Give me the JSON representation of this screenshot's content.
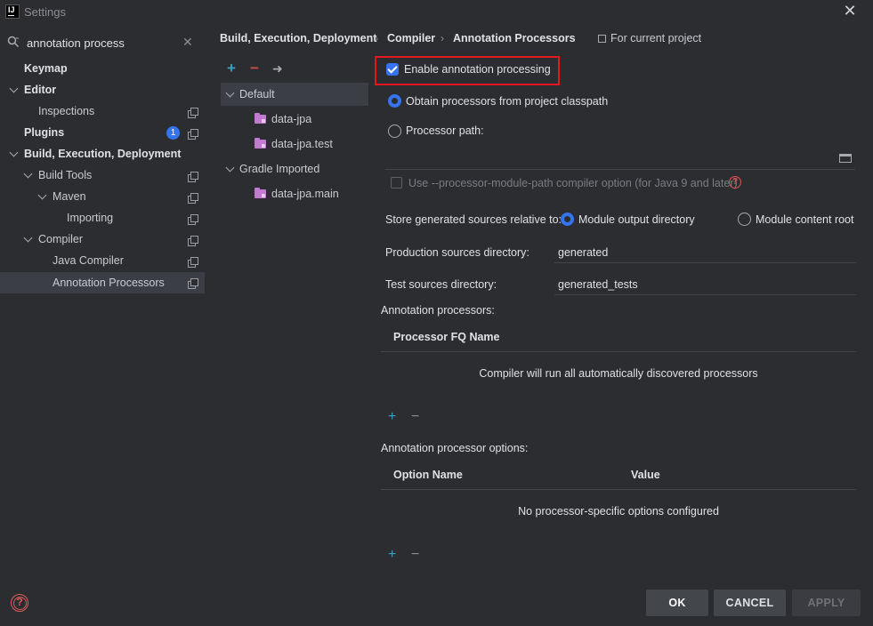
{
  "window": {
    "app_icon": "IJ",
    "title": "Settings"
  },
  "search": {
    "value": "annotation process"
  },
  "sidebar": {
    "items": [
      {
        "label": "Keymap"
      },
      {
        "label": "Editor"
      },
      {
        "label": "Inspections"
      },
      {
        "label": "Plugins",
        "badge": "1"
      },
      {
        "label": "Build, Execution, Deployment"
      },
      {
        "label": "Build Tools"
      },
      {
        "label": "Maven"
      },
      {
        "label": "Importing"
      },
      {
        "label": "Compiler"
      },
      {
        "label": "Java Compiler"
      },
      {
        "label": "Annotation Processors"
      }
    ]
  },
  "breadcrumb": {
    "items": [
      "Build, Execution, Deployment",
      "Compiler",
      "Annotation Processors"
    ],
    "separator": "›",
    "scope": "For current project"
  },
  "profiles": {
    "toolbar": {
      "add": "+",
      "remove": "−",
      "move": "➜"
    },
    "items": [
      {
        "label": "Default"
      },
      {
        "label": "data-jpa"
      },
      {
        "label": "data-jpa.test"
      },
      {
        "label": "Gradle Imported"
      },
      {
        "label": "data-jpa.main"
      }
    ]
  },
  "settings": {
    "enable_label": "Enable annotation processing",
    "obtain_label": "Obtain processors from project classpath",
    "processor_path_label": "Processor path:",
    "module_path_label": "Use --processor-module-path compiler option (for Java 9 and later)",
    "store_label": "Store generated sources relative to:",
    "module_output_label": "Module output directory",
    "module_content_label": "Module content root",
    "production_label": "Production sources directory:",
    "production_value": "generated",
    "test_label": "Test sources directory:",
    "test_value": "generated_tests"
  },
  "processors": {
    "section_label": "Annotation processors:",
    "column": "Processor FQ Name",
    "empty": "Compiler will run all automatically discovered processors"
  },
  "options": {
    "section_label": "Annotation processor options:",
    "col_name": "Option Name",
    "col_value": "Value",
    "empty": "No processor-specific options configured"
  },
  "table_toolbar": {
    "add": "+",
    "remove": "−"
  },
  "buttons": {
    "ok": "OK",
    "cancel": "CANCEL",
    "apply": "APPLY"
  },
  "colors": {
    "accent": "#3574f0",
    "highlight": "#e3171d",
    "folder": "#c27ad0"
  }
}
